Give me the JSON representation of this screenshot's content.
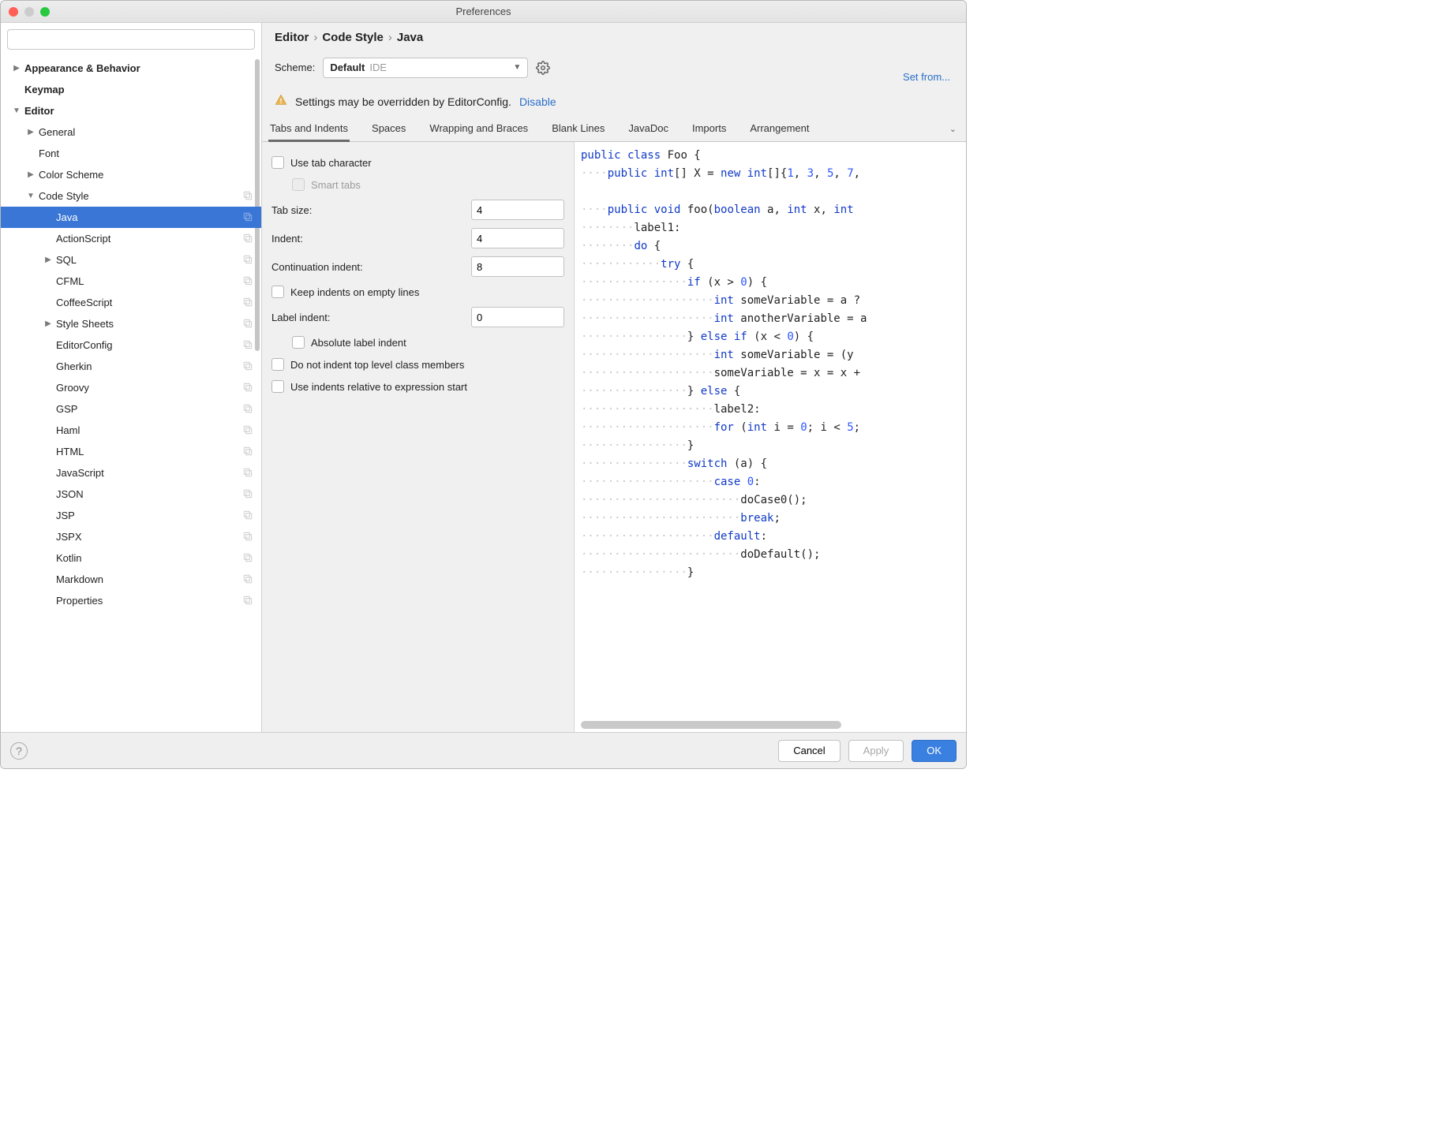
{
  "window": {
    "title": "Preferences"
  },
  "search": {
    "placeholder": ""
  },
  "tree": [
    {
      "label": "Appearance & Behavior",
      "indent": 0,
      "arrow": "right",
      "bold": true
    },
    {
      "label": "Keymap",
      "indent": 0,
      "arrow": "",
      "bold": true
    },
    {
      "label": "Editor",
      "indent": 0,
      "arrow": "down",
      "bold": true
    },
    {
      "label": "General",
      "indent": 1,
      "arrow": "right"
    },
    {
      "label": "Font",
      "indent": 1,
      "arrow": ""
    },
    {
      "label": "Color Scheme",
      "indent": 1,
      "arrow": "right"
    },
    {
      "label": "Code Style",
      "indent": 1,
      "arrow": "down",
      "copy": true
    },
    {
      "label": "Java",
      "indent": 2,
      "arrow": "",
      "copy": true,
      "selected": true
    },
    {
      "label": "ActionScript",
      "indent": 2,
      "arrow": "",
      "copy": true
    },
    {
      "label": "SQL",
      "indent": 2,
      "arrow": "right",
      "copy": true
    },
    {
      "label": "CFML",
      "indent": 2,
      "arrow": "",
      "copy": true
    },
    {
      "label": "CoffeeScript",
      "indent": 2,
      "arrow": "",
      "copy": true
    },
    {
      "label": "Style Sheets",
      "indent": 2,
      "arrow": "right",
      "copy": true
    },
    {
      "label": "EditorConfig",
      "indent": 2,
      "arrow": "",
      "copy": true
    },
    {
      "label": "Gherkin",
      "indent": 2,
      "arrow": "",
      "copy": true
    },
    {
      "label": "Groovy",
      "indent": 2,
      "arrow": "",
      "copy": true
    },
    {
      "label": "GSP",
      "indent": 2,
      "arrow": "",
      "copy": true
    },
    {
      "label": "Haml",
      "indent": 2,
      "arrow": "",
      "copy": true
    },
    {
      "label": "HTML",
      "indent": 2,
      "arrow": "",
      "copy": true
    },
    {
      "label": "JavaScript",
      "indent": 2,
      "arrow": "",
      "copy": true
    },
    {
      "label": "JSON",
      "indent": 2,
      "arrow": "",
      "copy": true
    },
    {
      "label": "JSP",
      "indent": 2,
      "arrow": "",
      "copy": true
    },
    {
      "label": "JSPX",
      "indent": 2,
      "arrow": "",
      "copy": true
    },
    {
      "label": "Kotlin",
      "indent": 2,
      "arrow": "",
      "copy": true
    },
    {
      "label": "Markdown",
      "indent": 2,
      "arrow": "",
      "copy": true
    },
    {
      "label": "Properties",
      "indent": 2,
      "arrow": "",
      "copy": true
    }
  ],
  "breadcrumb": [
    "Editor",
    "Code Style",
    "Java"
  ],
  "scheme": {
    "label": "Scheme:",
    "name": "Default",
    "suffix": "IDE"
  },
  "setfrom": "Set from...",
  "warning": {
    "text": "Settings may be overridden by EditorConfig.",
    "action": "Disable"
  },
  "tabs": [
    "Tabs and Indents",
    "Spaces",
    "Wrapping and Braces",
    "Blank Lines",
    "JavaDoc",
    "Imports",
    "Arrangement"
  ],
  "active_tab": 0,
  "form": {
    "use_tab": "Use tab character",
    "smart_tabs": "Smart tabs",
    "tab_size_lbl": "Tab size:",
    "tab_size": "4",
    "indent_lbl": "Indent:",
    "indent": "4",
    "cont_lbl": "Continuation indent:",
    "cont": "8",
    "keep_empty": "Keep indents on empty lines",
    "label_indent_lbl": "Label indent:",
    "label_indent": "0",
    "abs_label": "Absolute label indent",
    "no_top": "Do not indent top level class members",
    "rel_expr": "Use indents relative to expression start"
  },
  "footer": {
    "cancel": "Cancel",
    "apply": "Apply",
    "ok": "OK"
  },
  "code": [
    [
      [
        "kw",
        "public class"
      ],
      [
        "",
        " Foo {"
      ]
    ],
    [
      [
        "dots",
        "····"
      ],
      [
        "kw",
        "public int"
      ],
      [
        "",
        "[] X = "
      ],
      [
        "kw",
        "new int"
      ],
      [
        "",
        "[]{"
      ],
      [
        "num",
        "1"
      ],
      [
        "",
        ", "
      ],
      [
        "num",
        "3"
      ],
      [
        "",
        ", "
      ],
      [
        "num",
        "5"
      ],
      [
        "",
        ", "
      ],
      [
        "num",
        "7"
      ],
      [
        "",
        ","
      ]
    ],
    [
      [
        "dots",
        ""
      ]
    ],
    [
      [
        "dots",
        "····"
      ],
      [
        "kw",
        "public void"
      ],
      [
        "",
        " foo("
      ],
      [
        "kw",
        "boolean"
      ],
      [
        "",
        " a, "
      ],
      [
        "kw",
        "int"
      ],
      [
        "",
        " x, "
      ],
      [
        "kw",
        "int"
      ],
      [
        "",
        " "
      ]
    ],
    [
      [
        "dots",
        "········"
      ],
      [
        "",
        "label1:"
      ]
    ],
    [
      [
        "dots",
        "········"
      ],
      [
        "kw",
        "do"
      ],
      [
        "",
        " {"
      ]
    ],
    [
      [
        "dots",
        "············"
      ],
      [
        "kw",
        "try"
      ],
      [
        "",
        " {"
      ]
    ],
    [
      [
        "dots",
        "················"
      ],
      [
        "kw",
        "if"
      ],
      [
        "",
        " (x > "
      ],
      [
        "num",
        "0"
      ],
      [
        "",
        ") {"
      ]
    ],
    [
      [
        "dots",
        "····················"
      ],
      [
        "kw",
        "int"
      ],
      [
        "",
        " someVariable = a ?"
      ]
    ],
    [
      [
        "dots",
        "····················"
      ],
      [
        "kw",
        "int"
      ],
      [
        "",
        " anotherVariable = a"
      ]
    ],
    [
      [
        "dots",
        "················"
      ],
      [
        "",
        "} "
      ],
      [
        "kw",
        "else if"
      ],
      [
        "",
        " (x < "
      ],
      [
        "num",
        "0"
      ],
      [
        "",
        ") {"
      ]
    ],
    [
      [
        "dots",
        "····················"
      ],
      [
        "kw",
        "int"
      ],
      [
        "",
        " someVariable = (y "
      ]
    ],
    [
      [
        "dots",
        "····················"
      ],
      [
        "",
        "someVariable = x = x +"
      ]
    ],
    [
      [
        "dots",
        "················"
      ],
      [
        "",
        "} "
      ],
      [
        "kw",
        "else"
      ],
      [
        "",
        " {"
      ]
    ],
    [
      [
        "dots",
        "····················"
      ],
      [
        "",
        "label2:"
      ]
    ],
    [
      [
        "dots",
        "····················"
      ],
      [
        "kw",
        "for"
      ],
      [
        "",
        " ("
      ],
      [
        "kw",
        "int"
      ],
      [
        "",
        " i = "
      ],
      [
        "num",
        "0"
      ],
      [
        "",
        "; i < "
      ],
      [
        "num",
        "5"
      ],
      [
        "",
        ";"
      ]
    ],
    [
      [
        "dots",
        "················"
      ],
      [
        "",
        "}"
      ]
    ],
    [
      [
        "dots",
        "················"
      ],
      [
        "kw",
        "switch"
      ],
      [
        "",
        " (a) {"
      ]
    ],
    [
      [
        "dots",
        "····················"
      ],
      [
        "kw",
        "case"
      ],
      [
        "",
        " "
      ],
      [
        "num",
        "0"
      ],
      [
        "",
        ":"
      ]
    ],
    [
      [
        "dots",
        "························"
      ],
      [
        "",
        "doCase0();"
      ]
    ],
    [
      [
        "dots",
        "························"
      ],
      [
        "kw",
        "break"
      ],
      [
        "",
        ";"
      ]
    ],
    [
      [
        "dots",
        "····················"
      ],
      [
        "kw",
        "default"
      ],
      [
        "",
        ":"
      ]
    ],
    [
      [
        "dots",
        "························"
      ],
      [
        "",
        "doDefault();"
      ]
    ],
    [
      [
        "dots",
        "················"
      ],
      [
        "",
        "}"
      ]
    ]
  ]
}
